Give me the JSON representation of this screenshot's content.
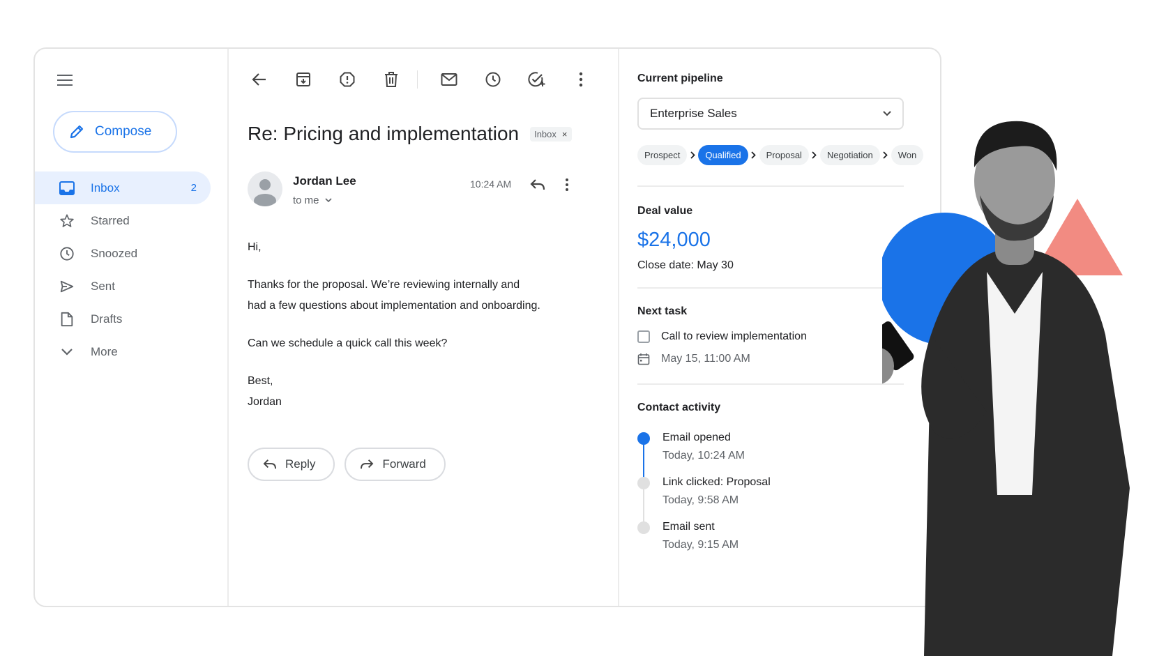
{
  "sidebar": {
    "compose_label": "Compose",
    "items": [
      {
        "label": "Inbox",
        "count": "2",
        "icon": "inbox-icon"
      },
      {
        "label": "Starred",
        "icon": "star-icon"
      },
      {
        "label": "Snoozed",
        "icon": "clock-icon"
      },
      {
        "label": "Sent",
        "icon": "send-icon"
      },
      {
        "label": "Drafts",
        "icon": "draft-icon"
      },
      {
        "label": "More",
        "icon": "chevron-down-icon"
      }
    ]
  },
  "toolbar": {
    "icons": [
      "back-arrow-icon",
      "archive-icon",
      "report-spam-icon",
      "delete-icon",
      "mark-unread-icon",
      "snooze-icon",
      "add-task-icon",
      "more-vert-icon"
    ]
  },
  "email": {
    "subject": "Re: Pricing and implementation",
    "label_chip": "Inbox",
    "label_chip_close": "×",
    "sender_name": "Jordan Lee",
    "recipient": "to me",
    "time": "10:24 AM",
    "body": {
      "greeting": "Hi,",
      "para1_line1": "Thanks for the proposal. We’re reviewing internally and",
      "para1_line2": "had a few questions about implementation and onboarding.",
      "para2": "Can we schedule a quick call this week?",
      "signoff": "Best,",
      "signature": "Jordan"
    },
    "reply_label": "Reply",
    "forward_label": "Forward"
  },
  "crm": {
    "pipeline_heading": "Current pipeline",
    "pipeline_selected": "Enterprise Sales",
    "stages": [
      "Prospect",
      "Qualified",
      "Proposal",
      "Negotiation",
      "Won"
    ],
    "active_stage": "Qualified",
    "deal_heading": "Deal value",
    "deal_value": "$24,000",
    "close_date": "Close date: May 30",
    "task_heading": "Next task",
    "task_title": "Call to review implementation",
    "task_due": "May 15, 11:00 AM",
    "activity_heading": "Contact activity",
    "activity": [
      {
        "title": "Email opened",
        "time": "Today, 10:24 AM",
        "active": true
      },
      {
        "title": "Link clicked: Proposal",
        "time": "Today, 9:58 AM",
        "active": false
      },
      {
        "title": "Email sent",
        "time": "Today, 9:15 AM",
        "active": false
      }
    ]
  },
  "colors": {
    "accent": "#1a73e8",
    "accent_light": "#e8f0fe",
    "deco_circle": "#1a73e8",
    "deco_triangle": "#f28b82"
  }
}
